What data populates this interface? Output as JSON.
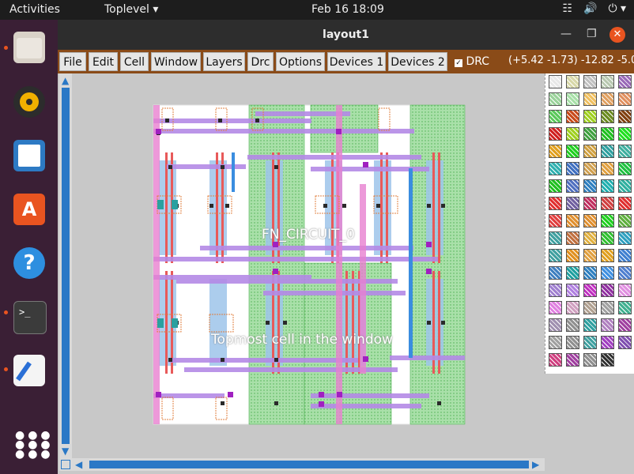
{
  "topbar": {
    "activities": "Activities",
    "app_menu": "Toplevel",
    "clock": "Feb 16  18:09"
  },
  "window": {
    "title": "layout1",
    "menu": [
      "File",
      "Edit",
      "Cell",
      "Window",
      "Layers",
      "Drc",
      "Options",
      "Devices 1",
      "Devices 2"
    ],
    "drc_label": "DRC",
    "coords": "(+5.42 -1.73) -12.82 -5.0"
  },
  "layout": {
    "cell_label_1": "FN_CIRCUIT_0",
    "cell_label_2": "Topmost cell in the window"
  },
  "colors": {
    "accent": "#e95420",
    "menubar_bg": "#8a4b18",
    "metal1": "#b48ae6",
    "poly": "#e85a5a",
    "pwell": "#7bd47b",
    "diffusion": "#9ec5ea"
  },
  "palette": [
    [
      "#e8e8e8",
      "#d8d8a8",
      "#c0c0c0",
      "#b8c8b0",
      "#9a6ab8"
    ],
    [
      "#9ad29a",
      "#a8e0a8",
      "#f0c060",
      "#e0a060",
      "#e09060"
    ],
    [
      "#5ac85a",
      "#c84a1a",
      "#a0d020",
      "#6a8a20",
      "#804010"
    ],
    [
      "#d02020",
      "#a0d020",
      "#40a040",
      "#20c020",
      "#20e020"
    ],
    [
      "#e0a020",
      "#20d020",
      "#d0a040",
      "#30a0a0",
      "#40b0a0"
    ],
    [
      "#30b0b0",
      "#4070c0",
      "#d0a050",
      "#e0a040",
      "#20c040"
    ],
    [
      "#20c020",
      "#5070c0",
      "#3080c0",
      "#20b0b0",
      "#30b0a0"
    ],
    [
      "#e03030",
      "#7060a0",
      "#c03060",
      "#d04040",
      "#e03030"
    ],
    [
      "#e04040",
      "#e09030",
      "#e09030",
      "#20d020",
      "#60b040"
    ],
    [
      "#40a0a0",
      "#c07040",
      "#e0b040",
      "#30c030",
      "#30a0c0"
    ],
    [
      "#40a0a0",
      "#e09020",
      "#e0a040",
      "#e0a020",
      "#4080d0"
    ],
    [
      "#4080c0",
      "#20a0a0",
      "#3080c0",
      "#4090e0",
      "#5080d0"
    ],
    [
      "#a080d0",
      "#b080e0",
      "#c030c0",
      "#9030a0",
      "#e090e0"
    ],
    [
      "#e080e0",
      "#d0a0c0",
      "#b0a090",
      "#a0a0a0",
      "#40b090"
    ],
    [
      "#a090b0",
      "#909090",
      "#30a0a0",
      "#b080c0",
      "#a040a0"
    ],
    [
      "#a0a0a0",
      "#909090",
      "#40a0a0",
      "#a040c0",
      "#8050b0"
    ],
    [
      "#d04080",
      "#a040a0",
      "#909090",
      "#303030",
      ""
    ]
  ]
}
